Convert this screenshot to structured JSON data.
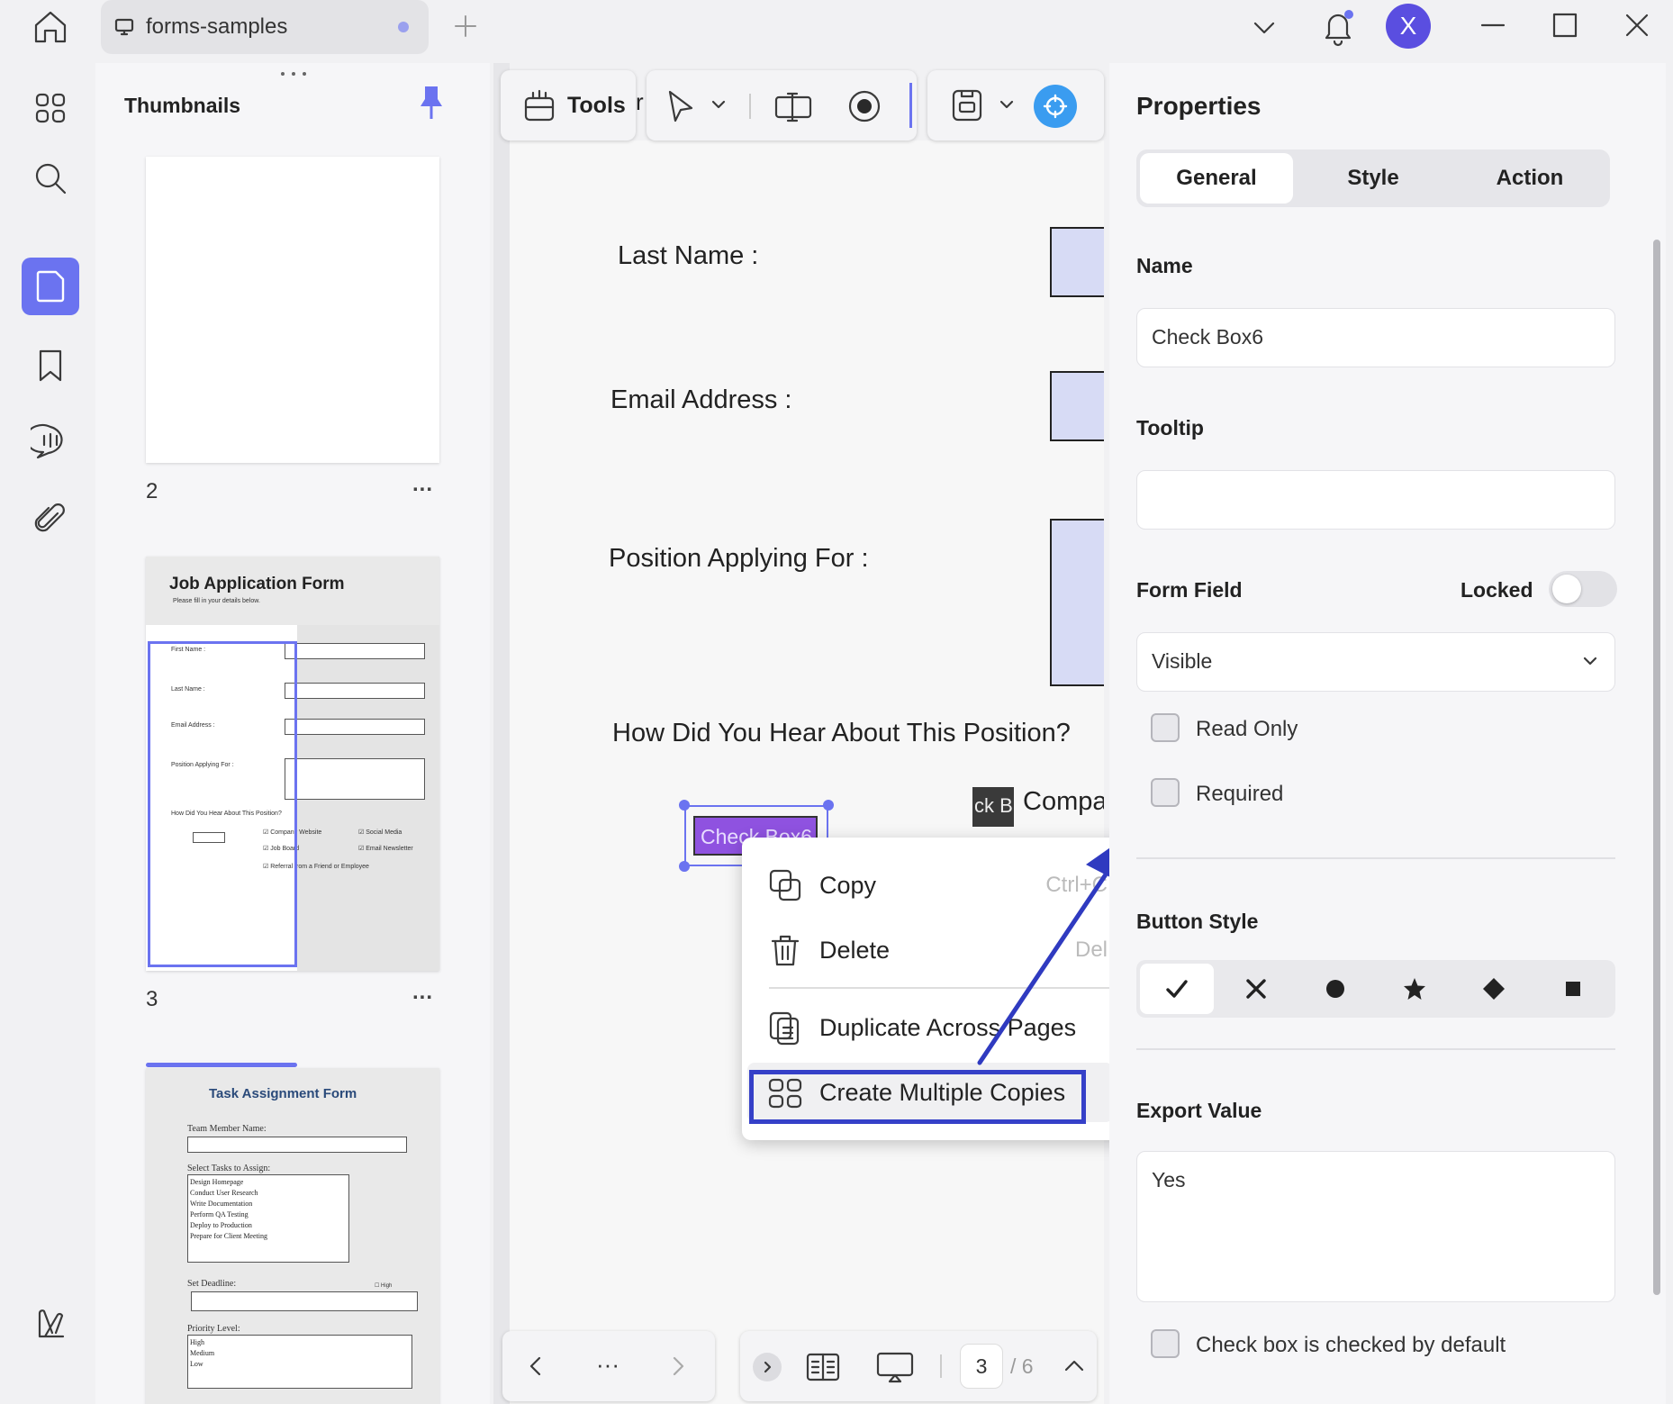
{
  "titlebar": {
    "tab_title": "forms-samples",
    "avatar_initial": "X"
  },
  "thumbnails": {
    "title": "Thumbnails",
    "pages": [
      {
        "number": "2",
        "more": "..."
      },
      {
        "number": "3",
        "more": "..."
      }
    ],
    "page3_preview": {
      "title": "Job Application Form",
      "subtitle": "Please fill in your details below.",
      "labels": [
        "First Name :",
        "Last Name :",
        "Email Address :",
        "Position Applying For :",
        "How Did You Hear About This Position?"
      ],
      "checks": [
        "Company Website",
        "Social Media",
        "Job Board",
        "Email Newsletter",
        "Referral from a Friend or Employee"
      ]
    },
    "page4_preview": {
      "title": "Task Assignment Form",
      "member_label": "Team Member Name:",
      "tasks_label": "Select Tasks to Assign:",
      "tasks": [
        "Design Homepage",
        "Conduct User Research",
        "Write Documentation",
        "Perform QA Testing",
        "Deploy to Production",
        "Prepare for Client Meeting"
      ],
      "deadline_label": "Set Deadline:",
      "high_tag": "☐ High",
      "priority_label": "Priority Level:",
      "priorities": [
        "High",
        "Medium",
        "Low"
      ]
    }
  },
  "toolbar": {
    "tools_label": "Tools",
    "tools_overflow": "r"
  },
  "document": {
    "fields": [
      "Last Name :",
      "Email Address :",
      "Position Applying For :"
    ],
    "question": "How Did You Hear About This Position?",
    "selected_field_text": "Check Box6",
    "neighbor_field_text": "ck B",
    "neighbor_label": "Compa"
  },
  "context_menu": {
    "items": [
      {
        "label": "Copy",
        "shortcut": "Ctrl+C"
      },
      {
        "label": "Delete",
        "shortcut": "Del"
      },
      {
        "label": "Duplicate Across Pages",
        "shortcut": ""
      },
      {
        "label": "Create Multiple Copies",
        "shortcut": ""
      }
    ]
  },
  "properties": {
    "title": "Properties",
    "tabs": [
      "General",
      "Style",
      "Action"
    ],
    "active_tab": "General",
    "name_label": "Name",
    "name_value": "Check Box6",
    "tooltip_label": "Tooltip",
    "tooltip_value": "",
    "form_field_label": "Form Field",
    "locked_label": "Locked",
    "locked": false,
    "visibility_value": "Visible",
    "read_only_label": "Read Only",
    "required_label": "Required",
    "button_style_label": "Button Style",
    "button_styles": [
      "check",
      "cross",
      "circle",
      "star",
      "diamond",
      "square"
    ],
    "selected_button_style": "check",
    "export_value_label": "Export Value",
    "export_value": "Yes",
    "default_checked_label": "Check box is checked by default"
  },
  "pagination": {
    "more": "···",
    "current_page": "3",
    "total_pages": "/ 6"
  },
  "colors": {
    "accent": "#6b73f0",
    "field_fill": "#d7dbf5",
    "selected_field": "#8f52e0",
    "highlight_box": "#3540c8",
    "arrow": "#2f3ac0"
  }
}
